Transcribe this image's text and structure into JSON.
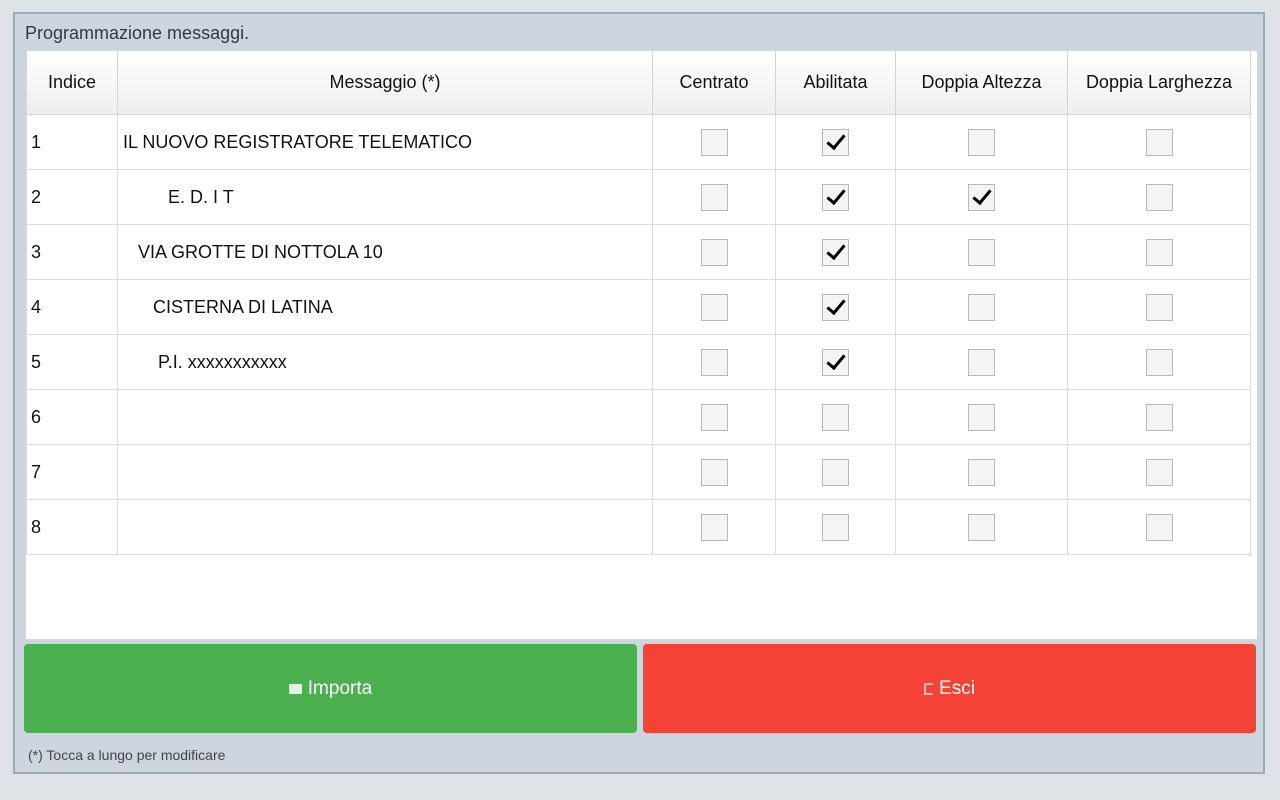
{
  "dialog": {
    "title": "Programmazione messaggi."
  },
  "table": {
    "headers": [
      "Indice",
      "Messaggio (*)",
      "Centrato",
      "Abilitata",
      "Doppia Altezza",
      "Doppia Larghezza"
    ],
    "rows": [
      {
        "index": "1",
        "message": "IL NUOVO REGISTRATORE TELEMATICO",
        "centrato": false,
        "abilitata": true,
        "doppia_altezza": false,
        "doppia_larghezza": false
      },
      {
        "index": "2",
        "message": "         E. D. I T",
        "centrato": false,
        "abilitata": true,
        "doppia_altezza": true,
        "doppia_larghezza": false
      },
      {
        "index": "3",
        "message": "   VIA GROTTE DI NOTTOLA 10",
        "centrato": false,
        "abilitata": true,
        "doppia_altezza": false,
        "doppia_larghezza": false
      },
      {
        "index": "4",
        "message": "      CISTERNA DI LATINA",
        "centrato": false,
        "abilitata": true,
        "doppia_altezza": false,
        "doppia_larghezza": false
      },
      {
        "index": "5",
        "message": "       P.I. xxxxxxxxxxx",
        "centrato": false,
        "abilitata": true,
        "doppia_altezza": false,
        "doppia_larghezza": false
      },
      {
        "index": "6",
        "message": "",
        "centrato": false,
        "abilitata": false,
        "doppia_altezza": false,
        "doppia_larghezza": false
      },
      {
        "index": "7",
        "message": "",
        "centrato": false,
        "abilitata": false,
        "doppia_altezza": false,
        "doppia_larghezza": false
      },
      {
        "index": "8",
        "message": "",
        "centrato": false,
        "abilitata": false,
        "doppia_altezza": false,
        "doppia_larghezza": false
      }
    ]
  },
  "buttons": {
    "import_label": "Importa",
    "import_icon": "folder-icon",
    "exit_label": "Esci",
    "exit_icon": "exit-icon"
  },
  "footnote": "(*) Tocca a lungo per modificare",
  "colors": {
    "import": "#4caf50",
    "exit": "#f44336",
    "dialog_bg": "#cdd5df"
  }
}
